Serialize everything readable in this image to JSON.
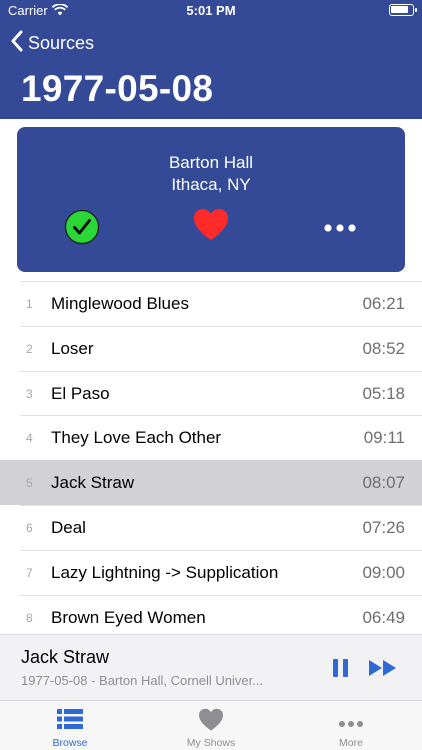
{
  "status_bar": {
    "carrier": "Carrier",
    "time": "5:01 PM",
    "battery_level": 0.85
  },
  "nav": {
    "back_label": "Sources",
    "title": "1977-05-08"
  },
  "venue": {
    "name": "Barton Hall",
    "location": "Ithaca, NY"
  },
  "card_actions": [
    {
      "icon": "check-circle-icon",
      "color": "#2bd637"
    },
    {
      "icon": "heart-icon",
      "color": "#ff2a2a"
    },
    {
      "icon": "more-icon",
      "color": "#ffffff"
    }
  ],
  "tracks": [
    {
      "num": "1",
      "title": "Minglewood Blues",
      "duration": "06:21"
    },
    {
      "num": "2",
      "title": "Loser",
      "duration": "08:52"
    },
    {
      "num": "3",
      "title": "El Paso",
      "duration": "05:18"
    },
    {
      "num": "4",
      "title": "They Love Each Other",
      "duration": "09:11"
    },
    {
      "num": "5",
      "title": "Jack Straw",
      "duration": "08:07",
      "selected": true
    },
    {
      "num": "6",
      "title": "Deal",
      "duration": "07:26"
    },
    {
      "num": "7",
      "title": "Lazy Lightning -> Supplication",
      "duration": "09:00"
    },
    {
      "num": "8",
      "title": "Brown Eyed Women",
      "duration": "06:49"
    }
  ],
  "now_playing": {
    "title": "Jack Straw",
    "subtitle": "1977-05-08 - Barton Hall, Cornell Univer..."
  },
  "tabs": [
    {
      "label": "Browse",
      "icon": "browse-list-icon",
      "active": true
    },
    {
      "label": "My Shows",
      "icon": "heart-icon",
      "active": false
    },
    {
      "label": "More",
      "icon": "more-icon",
      "active": false
    }
  ],
  "colors": {
    "header": "#354a97",
    "accent": "#2f6ad4",
    "selected_row": "#d1d1d6"
  }
}
